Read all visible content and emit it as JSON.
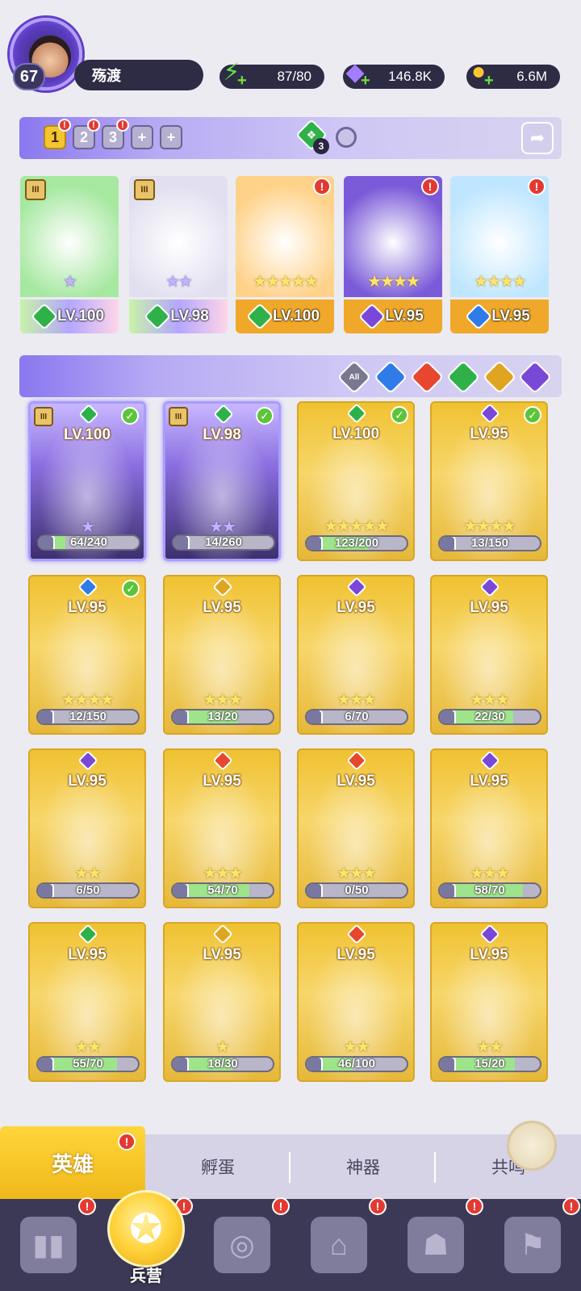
{
  "profile": {
    "level": "67",
    "name": "殇渡"
  },
  "resources": {
    "energy": "87/80",
    "gems": "146.8K",
    "coins": "6.6M"
  },
  "team_tabs": [
    "1",
    "2",
    "3",
    "+",
    "+"
  ],
  "team_center": {
    "count": "3"
  },
  "team": [
    {
      "level": "LV.100",
      "element": "wind",
      "stars": "★",
      "star_color": "purple",
      "bg": "#a6e8a0",
      "tier": "III"
    },
    {
      "level": "LV.98",
      "element": "wind",
      "stars": "★★",
      "star_color": "purple",
      "bg": "#e2e0f0",
      "tier": "III"
    },
    {
      "level": "LV.100",
      "element": "wind",
      "stars": "★★★★★",
      "star_color": "gold",
      "bg": "#ffd28a",
      "alert": true
    },
    {
      "level": "LV.95",
      "element": "dark",
      "stars": "★★★★",
      "star_color": "gold",
      "bg": "#7a5ad8",
      "alert": true
    },
    {
      "level": "LV.95",
      "element": "water",
      "stars": "★★★★",
      "star_color": "gold",
      "bg": "#bfe6ff",
      "alert": true
    }
  ],
  "filters": [
    "All",
    "water",
    "fire",
    "wind",
    "light",
    "dark"
  ],
  "heroes": [
    {
      "level": "LV.100",
      "element": "wind",
      "stars": "★",
      "star_color": "purple",
      "progress": "64/240",
      "ratio": 0.27,
      "check": true,
      "tier": "III",
      "theme": "purple"
    },
    {
      "level": "LV.98",
      "element": "wind",
      "stars": "★★",
      "star_color": "purple",
      "progress": "14/260",
      "ratio": 0.05,
      "check": true,
      "tier": "III",
      "theme": "purple"
    },
    {
      "level": "LV.100",
      "element": "wind",
      "stars": "★★★★★",
      "star_color": "gold",
      "progress": "123/200",
      "ratio": 0.62,
      "check": true,
      "theme": "gold"
    },
    {
      "level": "LV.95",
      "element": "dark",
      "stars": "★★★★",
      "star_color": "gold",
      "progress": "13/150",
      "ratio": 0.09,
      "check": true,
      "theme": "gold"
    },
    {
      "level": "LV.95",
      "element": "water",
      "stars": "★★★★",
      "star_color": "gold",
      "progress": "12/150",
      "ratio": 0.08,
      "check": true,
      "theme": "gold"
    },
    {
      "level": "LV.95",
      "element": "light",
      "stars": "★★★",
      "star_color": "gold",
      "progress": "13/20",
      "ratio": 0.65,
      "theme": "gold"
    },
    {
      "level": "LV.95",
      "element": "dark",
      "stars": "★★★",
      "star_color": "gold",
      "progress": "6/70",
      "ratio": 0.09,
      "theme": "gold"
    },
    {
      "level": "LV.95",
      "element": "dark",
      "stars": "★★★",
      "star_color": "gold",
      "progress": "22/30",
      "ratio": 0.73,
      "theme": "gold"
    },
    {
      "level": "LV.95",
      "element": "dark",
      "stars": "★★",
      "star_color": "gold",
      "progress": "6/50",
      "ratio": 0.12,
      "theme": "gold"
    },
    {
      "level": "LV.95",
      "element": "fire",
      "stars": "★★★",
      "star_color": "gold",
      "progress": "54/70",
      "ratio": 0.77,
      "theme": "gold"
    },
    {
      "level": "LV.95",
      "element": "fire",
      "stars": "★★★",
      "star_color": "gold",
      "progress": "0/50",
      "ratio": 0,
      "theme": "gold"
    },
    {
      "level": "LV.95",
      "element": "dark",
      "stars": "★★★",
      "star_color": "gold",
      "progress": "58/70",
      "ratio": 0.83,
      "theme": "gold"
    },
    {
      "level": "LV.95",
      "element": "wind",
      "stars": "★★",
      "star_color": "gold",
      "progress": "55/70",
      "ratio": 0.79,
      "theme": "gold"
    },
    {
      "level": "LV.95",
      "element": "light",
      "stars": "★",
      "star_color": "gold",
      "progress": "18/30",
      "ratio": 0.6,
      "theme": "gold"
    },
    {
      "level": "LV.95",
      "element": "fire",
      "stars": "★★",
      "star_color": "gold",
      "progress": "46/100",
      "ratio": 0.46,
      "theme": "gold"
    },
    {
      "level": "LV.95",
      "element": "dark",
      "stars": "★★",
      "star_color": "gold",
      "progress": "15/20",
      "ratio": 0.75,
      "theme": "gold"
    }
  ],
  "sub_tabs": {
    "active": "英雄",
    "items": [
      "孵蛋",
      "神器",
      "共鸣"
    ]
  },
  "bottom_nav": {
    "active_label": "兵营"
  },
  "colors": {
    "water": "#2f7be8",
    "fire": "#e8472f",
    "wind": "#2fb14a",
    "light": "#e0a520",
    "dark": "#7a48d8"
  }
}
